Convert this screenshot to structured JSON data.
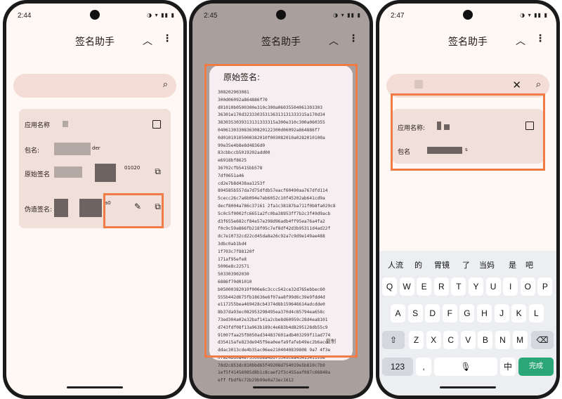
{
  "app_title": "签名助手",
  "phone1": {
    "time": "2:44",
    "label_app_name": "应用名称",
    "label_package": "包名:",
    "package_suffix": "der",
    "label_original_sig": "原始签名",
    "original_sig_tail": "01020",
    "label_fake_sig": "伪造签名:",
    "fake_sig_tail": "a0"
  },
  "phone2": {
    "time": "2:45",
    "dialog_title": "原始签名:",
    "signature_lines": [
      "308202903081",
      "300d06092a864886f70",
      "d01010b0500300e310c300a06035504061303303",
      "36301e170d323330353136313131333315a170d34",
      "3830353039313131333315a300e310c300a060355",
      "040613033083630820122300d06092a864886f7",
      "0d01010105000382010f003082010a0282010100a",
      "99e35e4b8e8d4836d0",
      "83cbbccb5019202add00",
      "e6918bf8625",
      "36702cfb5415bb578",
      "7df0651a46",
      "cd2e7b8d438aa1253f",
      "894585b557da7d75dfdb57eacf60490aa767dfd114",
      "5cecc26c7a6b094e7eb6052c10f45202ab641cd9a",
      "decf8004a786c37161 2fa1c38187ba711f0b8fa029c8",
      "5c0c5f0002fc6651a2fc0ba38953ff7b2c3f49d9acb",
      "d3f655e682cf84e57e298d96adb4ff95ea76a4fa2",
      "f0c9c59a866fb218f05c7ef8df42d3b95311d4ad22f",
      "dc7e10732cd22cd45da8a26c92a7c9d9e149ae488",
      "3dbc0ab1bd4",
      "1f703c7f88120f",
      "171af95efe8",
      "5006e8c22571",
      "503303902030",
      "6886f70d01010",
      "b05000382010f006e6c3ccc542ce32d765ebbec60",
      "555b442d675fb18636e6f07aa8f99d6c39e9fdd4d",
      "e117255bea469428cb4374d8b159646614adcdde0",
      "8b37da93ec082953298495ea370d4c85794ea658c",
      "73ed304a02e32baf141a2cbe8d60959c28d4ea8101",
      "d743fdf08f13a963b189c4e683b4d8295128db55c9",
      "91007faa25f8050ad344837601adb403299f11ad774",
      "d35415afe823de945f9ea0eefa9fafeb49ec2b6acd",
      "ddac3013cde4b35ac06ee2104040839808 9a7 4f3e",
      "07a24bd0a4ef5500bea4b0f5349cea4541541199e",
      "78d2c853dc810bbd65f49208d754019e5b810c7b9",
      "1ef5f41456985d8b1c8caef2f3c455aaf087c66848a",
      "eff fbdf6c72b29b99e0a73ec1612"
    ],
    "copy_label": "复制"
  },
  "phone3": {
    "time": "2:47",
    "label_app_name": "应用名称:",
    "label_package": "包名",
    "package_suffix": "s",
    "candidates": [
      "人流",
      "的",
      "胃镜",
      "了",
      "当妈",
      "是",
      "吧"
    ],
    "row1": [
      "Q",
      "W",
      "E",
      "R",
      "T",
      "Y",
      "U",
      "I",
      "O",
      "P"
    ],
    "row2": [
      "A",
      "S",
      "D",
      "F",
      "G",
      "H",
      "J",
      "K",
      "L"
    ],
    "row3": [
      "Z",
      "X",
      "C",
      "V",
      "B",
      "N",
      "M"
    ],
    "key_123": "123",
    "key_lang": "中",
    "key_done": "完成"
  },
  "icons": {
    "chevron_up": "chevron-up-icon",
    "more": "more-vert-icon",
    "search": "search-icon",
    "copy": "copy-icon",
    "edit": "edit-icon",
    "checkbox": "checkbox-icon",
    "shift": "shift-icon",
    "backspace": "backspace-icon",
    "mic": "mic-icon",
    "close": "close-icon"
  },
  "colors": {
    "highlight": "#f07b47",
    "surface": "#fff8f5",
    "card": "#f1dfd9",
    "search_bar": "#f3ddd6",
    "done_key": "#2ba679"
  }
}
